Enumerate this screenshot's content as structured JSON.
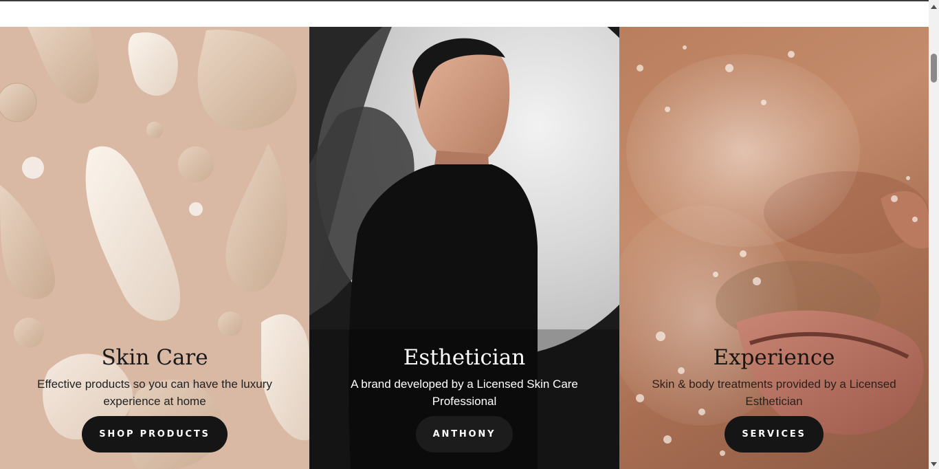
{
  "panels": [
    {
      "title": "Skin Care",
      "description": "Effective products so you can have the luxury experience at home",
      "button": "SHOP PRODUCTS"
    },
    {
      "title": "Esthetician",
      "description": "A brand developed by a Licensed Skin Care Professional",
      "button": "ANTHONY"
    },
    {
      "title": "Experience",
      "description": "Skin & body treatments provided by a Licensed Esthetician",
      "button": "SERVICES"
    }
  ],
  "colors": {
    "button_bg": "#151515",
    "button_text": "#ffffff",
    "panel1_bg": "#d9b9a3",
    "panel2_bg": "#1b1b1b",
    "panel3_bg": "#b97e5e"
  }
}
